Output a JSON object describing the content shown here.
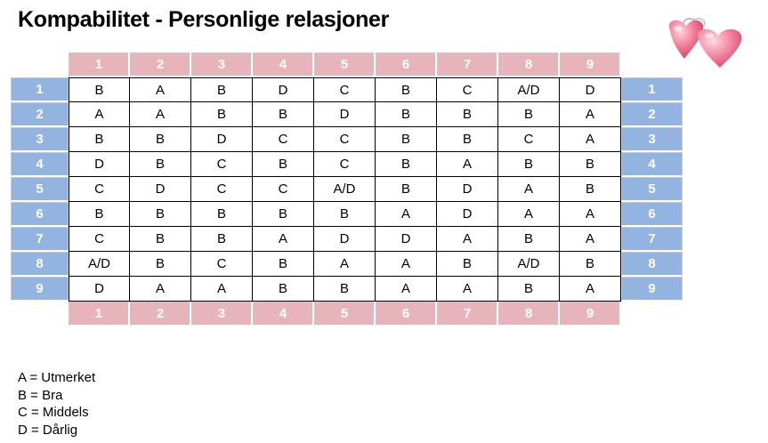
{
  "title": "Kompabilitet - Personlige relasjoner",
  "column_numbers": [
    "1",
    "2",
    "3",
    "4",
    "5",
    "6",
    "7",
    "8",
    "9"
  ],
  "row_numbers": [
    "1",
    "2",
    "3",
    "4",
    "5",
    "6",
    "7",
    "8",
    "9"
  ],
  "grid": [
    [
      "B",
      "A",
      "B",
      "D",
      "C",
      "B",
      "C",
      "A/D",
      "D"
    ],
    [
      "A",
      "A",
      "B",
      "B",
      "D",
      "B",
      "B",
      "B",
      "A"
    ],
    [
      "B",
      "B",
      "D",
      "C",
      "C",
      "B",
      "B",
      "C",
      "A"
    ],
    [
      "D",
      "B",
      "C",
      "B",
      "C",
      "B",
      "A",
      "B",
      "B"
    ],
    [
      "C",
      "D",
      "C",
      "C",
      "A/D",
      "B",
      "D",
      "A",
      "B"
    ],
    [
      "B",
      "B",
      "B",
      "B",
      "B",
      "A",
      "D",
      "A",
      "A"
    ],
    [
      "C",
      "B",
      "B",
      "A",
      "D",
      "D",
      "A",
      "B",
      "A"
    ],
    [
      "A/D",
      "B",
      "C",
      "B",
      "A",
      "A",
      "B",
      "A/D",
      "B"
    ],
    [
      "D",
      "A",
      "A",
      "B",
      "B",
      "A",
      "A",
      "B",
      "A"
    ]
  ],
  "legend": [
    "A = Utmerket",
    "B = Bra",
    "C = Middels",
    "D = Dårlig"
  ],
  "decoration": {
    "icon": "hearts-icon",
    "color_pink": "#e8b4bc",
    "color_blue": "#93b4e0"
  }
}
